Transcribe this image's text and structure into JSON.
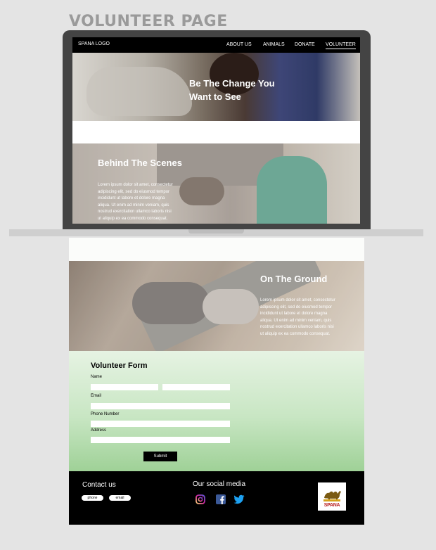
{
  "page_heading": "VOLUNTEER PAGE",
  "navbar": {
    "logo": "SPANA LOGO",
    "items": [
      {
        "label": "ABOUT US"
      },
      {
        "label": "ANIMALS"
      },
      {
        "label": "DONATE"
      },
      {
        "label": "VOLUNTEER",
        "active": true
      }
    ]
  },
  "hero": {
    "title_line1": "Be The Change You",
    "title_line2": "Want to See"
  },
  "behind_scenes": {
    "title": "Behind The Scenes",
    "body_lines": [
      "Lorem ipsum dolor sit amet, consectetur",
      "adipiscing elit, sed do eiusmod tempor",
      "incididunt ut labore et dolore magna",
      "aliqua. Ut enim ad minim veniam, quis",
      "nostrud exercitation ullamco laboris nisi",
      "ut aliquip ex ea commodo consequat."
    ]
  },
  "on_the_ground": {
    "title": "On The Ground",
    "body_lines": [
      "Lorem ipsum dolor sit amet, consectetur",
      "adipiscing elit, sed do eiusmod tempor",
      "incididunt ut labore et dolore magna",
      "aliqua. Ut enim ad minim veniam, quis",
      "nostrud exercitation ullamco laboris nisi",
      "ut aliquip ex ea commodo consequat."
    ]
  },
  "form": {
    "title": "Volunteer Form",
    "name_label": "Name",
    "email_label": "Email",
    "phone_label": "Phone Number",
    "address_label": "Address",
    "submit_label": "Submit"
  },
  "footer": {
    "contact_title": "Contact us",
    "phone_label": "phone",
    "email_label": "email",
    "social_title": "Our social media",
    "social_icons": [
      "instagram-icon",
      "facebook-icon",
      "twitter-icon"
    ],
    "brand": "SPANA"
  },
  "colors": {
    "instagram": "#d6249f",
    "facebook": "#3b5998",
    "twitter": "#1da1f2",
    "spana_red": "#b71c1c"
  }
}
